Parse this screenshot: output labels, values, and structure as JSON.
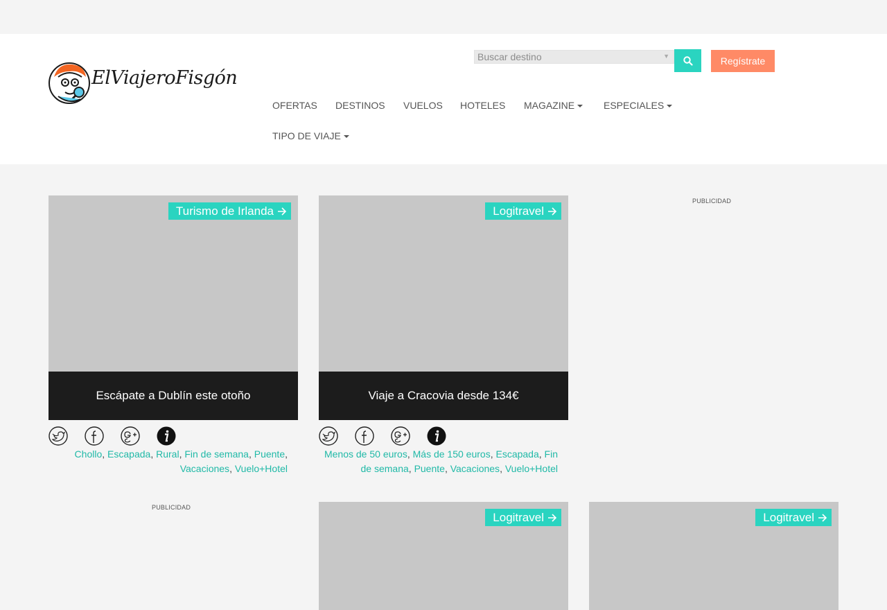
{
  "site": {
    "logo_text": "ElViajeroFisgón"
  },
  "search": {
    "placeholder": "Buscar destino"
  },
  "buttons": {
    "register": "Regístrate"
  },
  "nav": {
    "ofertas": "OFERTAS",
    "destinos": "DESTINOS",
    "vuelos": "VUELOS",
    "hoteles": "HOTELES",
    "magazine": "MAGAZINE",
    "especiales": "ESPECIALES",
    "tipo_viaje": "TIPO DE VIAJE"
  },
  "ads": {
    "label": "PUBLICIDAD"
  },
  "cards": [
    {
      "tag": "Turismo de Irlanda",
      "title": "Escápate a Dublín este otoño",
      "tags": [
        "Chollo",
        "Escapada",
        "Rural",
        "Fin de semana",
        "Puente",
        "Vacaciones",
        "Vuelo+Hotel"
      ]
    },
    {
      "tag": "Logitravel",
      "title": "Viaje a Cracovia desde 134€",
      "tags": [
        "Menos de 50 euros",
        "Más de 150 euros",
        "Escapada",
        "Fin de semana",
        "Puente",
        "Vacaciones",
        "Vuelo+Hotel"
      ]
    },
    {
      "tag": "Logitravel"
    },
    {
      "tag": "Logitravel"
    }
  ],
  "colors": {
    "accent": "#2ad4c0",
    "register": "#ff8a66",
    "caption_bg": "#1c1c1c",
    "link": "#20b9a7"
  }
}
